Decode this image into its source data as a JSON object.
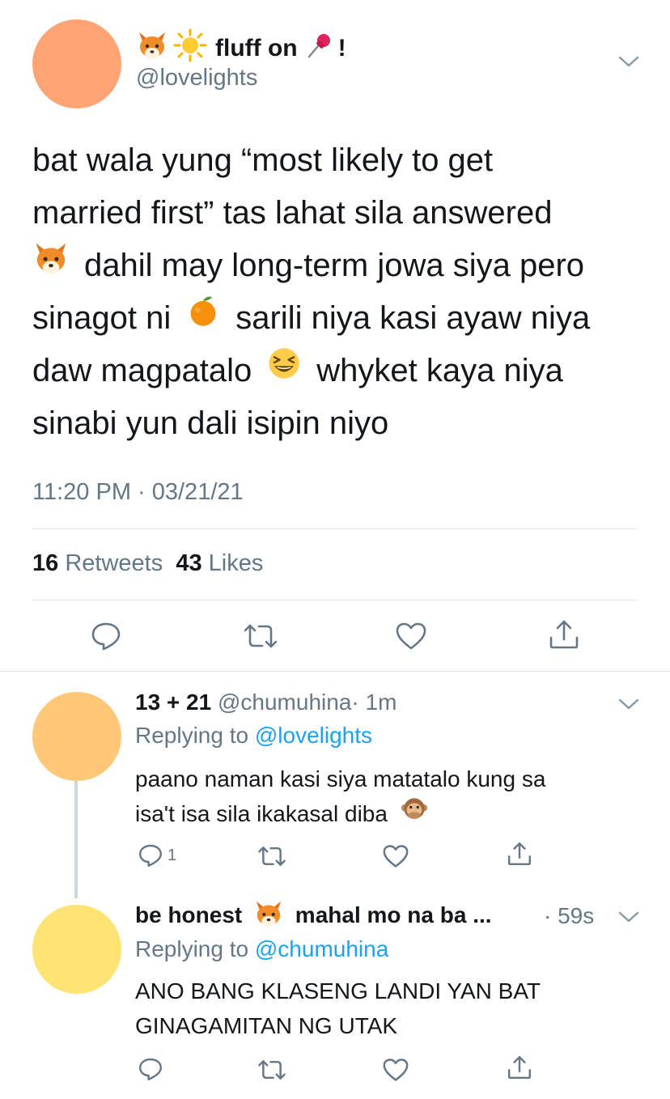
{
  "colors": {
    "text": "#14171a",
    "secondary": "#657786",
    "link": "#1da1f2",
    "divider": "#e1e8ed",
    "main_avatar": "#ffa575",
    "reply1_avatar": "#ffc878",
    "reply2_avatar": "#fde474"
  },
  "main_tweet": {
    "display_name_icons": [
      "fox-emoji",
      "sun-emoji"
    ],
    "display_name": "fluff on",
    "display_name_suffix_icon": "pushpin-emoji",
    "display_name_suffix": "!",
    "handle": "@lovelights",
    "text_lines": [
      {
        "parts": [
          "bat wala yung “most likely to get"
        ]
      },
      {
        "parts": [
          "married first” tas lahat sila answered"
        ]
      },
      {
        "parts": [
          "dahil may long-term jowa siya pero"
        ],
        "leading_icon": "fox-emoji"
      },
      {
        "parts": [
          "sinagot ni",
          "sarili niya kasi ayaw niya"
        ],
        "inline_icon": "tangerine-emoji"
      },
      {
        "parts": [
          "daw magpatalo",
          "whyket kaya niya"
        ],
        "inline_icon": "laughing-emoji"
      },
      {
        "parts": [
          "sinabi yun dali isipin niyo"
        ]
      }
    ],
    "timestamp": "11:20 PM · 03/21/21",
    "retweets_count": "16",
    "retweets_label": "Retweets",
    "likes_count": "43",
    "likes_label": "Likes",
    "actions": [
      "reply-icon",
      "retweet-icon",
      "like-icon",
      "share-icon"
    ]
  },
  "replies": [
    {
      "display_name": "13 + 21",
      "handle": "@chumuhina",
      "time": "· 1m",
      "replying_to_label": "Replying to",
      "replying_to": "@lovelights",
      "text_lines": [
        "paano naman kasi siya matatalo kung sa",
        "isa't isa sila ikakasal diba"
      ],
      "trailing_icon": "speak-no-evil-monkey-emoji",
      "reply_count": "1"
    },
    {
      "display_name_start": "be honest",
      "display_name_icon": "fox-emoji",
      "display_name_end": "mahal mo na ba ...",
      "time": "· 59s",
      "replying_to_label": "Replying to",
      "replying_to": "@chumuhina",
      "text_lines": [
        "ANO BANG KLASENG LANDI YAN BAT",
        "GINAGAMITAN NG UTAK"
      ]
    }
  ]
}
